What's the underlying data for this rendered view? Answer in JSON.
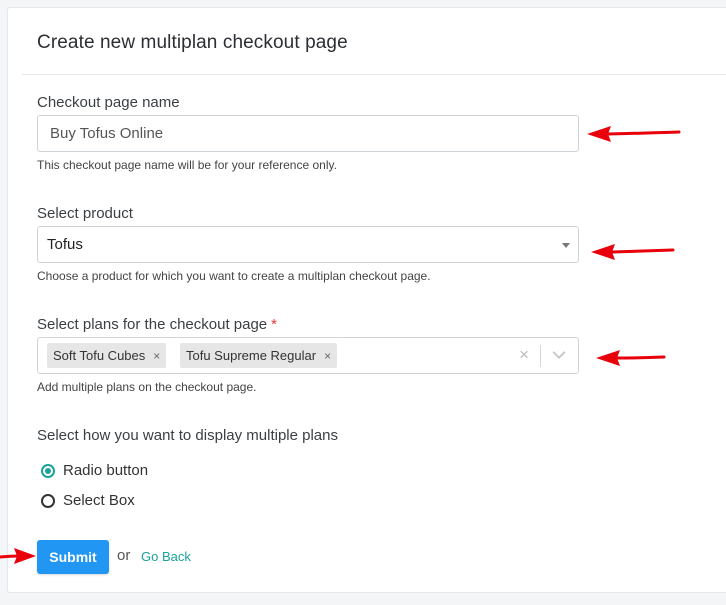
{
  "form": {
    "title": "Create new multiplan checkout page",
    "name_label": "Checkout page name",
    "name_value": "Buy Tofus Online",
    "name_help": "This checkout page name will be for your reference only.",
    "product_label": "Select product",
    "product_value": "Tofus",
    "product_help": "Choose a product for which you want to create a multiplan checkout page.",
    "plans_label": "Select plans for the checkout page",
    "plans_required": "*",
    "plans": [
      {
        "label": "Soft Tofu Cubes",
        "remove": "×"
      },
      {
        "label": "Tofu Supreme Regular",
        "remove": "×"
      }
    ],
    "plans_clear": "×",
    "plans_help": "Add multiple plans on the checkout page.",
    "display_label": "Select how you want to display multiple plans",
    "display_options": [
      {
        "label": "Radio button",
        "checked": true
      },
      {
        "label": "Select Box",
        "checked": false
      }
    ],
    "submit_label": "Submit",
    "or_text": "or",
    "go_back_label": "Go Back"
  },
  "colors": {
    "accent": "#1aa39a",
    "primary_button": "#2196f3",
    "annotation_arrow": "#e8000b",
    "required": "#e53935"
  }
}
